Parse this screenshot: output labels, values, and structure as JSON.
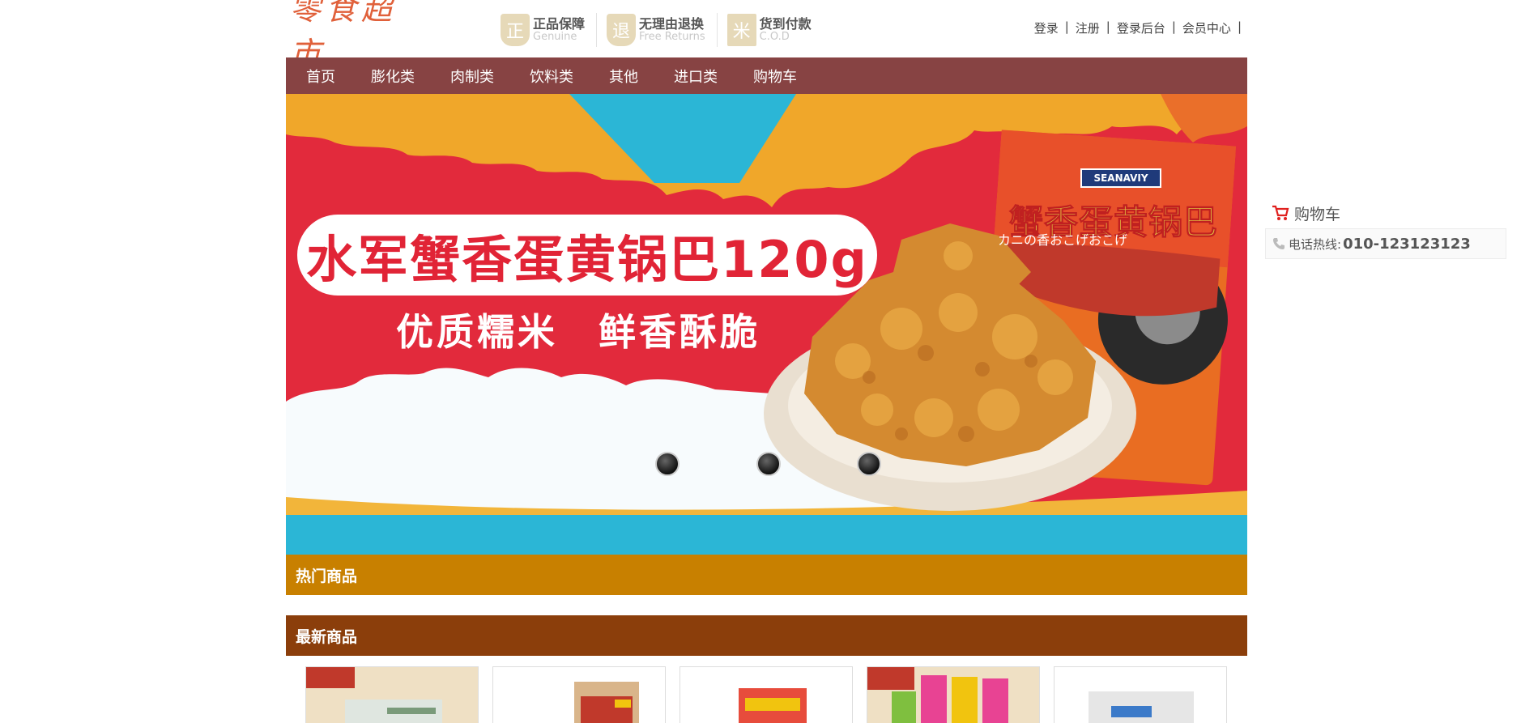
{
  "logo": {
    "text": "零食超市"
  },
  "badges": [
    {
      "icon": "genuine-seal-icon",
      "glyph": "正",
      "cn": "正品保障",
      "en": "Genuine"
    },
    {
      "icon": "returns-seal-icon",
      "glyph": "退",
      "cn": "无理由退换",
      "en": "Free Returns"
    },
    {
      "icon": "cod-icon",
      "glyph": "米",
      "cn": "货到付款",
      "en": "C.O.D"
    }
  ],
  "toplinks": {
    "login": "登录",
    "register": "注册",
    "admin": "登录后台",
    "member": "会员中心",
    "sep": "|"
  },
  "nav": [
    "首页",
    "膨化类",
    "肉制类",
    "饮料类",
    "其他",
    "进口类",
    "购物车"
  ],
  "banner": {
    "headline": "水军蟹香蛋黄锅巴120g",
    "subline": "优质糯米　鲜香酥脆",
    "package_brand": "SEANAVIY",
    "package_title": "蟹香蛋黄锅巴",
    "package_jp": "カニの香おこげおこげ",
    "dots": 3
  },
  "sections": {
    "hot": "热门商品",
    "new": "最新商品"
  },
  "side": {
    "cart_label": "购物车",
    "phone_label": "电话热线:",
    "phone_number": "010-123123123"
  },
  "colors": {
    "nav": "#874343",
    "hot_bar": "#c88000",
    "new_bar": "#8b3e0b",
    "banner_red": "#e22a3c",
    "logo": "#e0603a"
  }
}
